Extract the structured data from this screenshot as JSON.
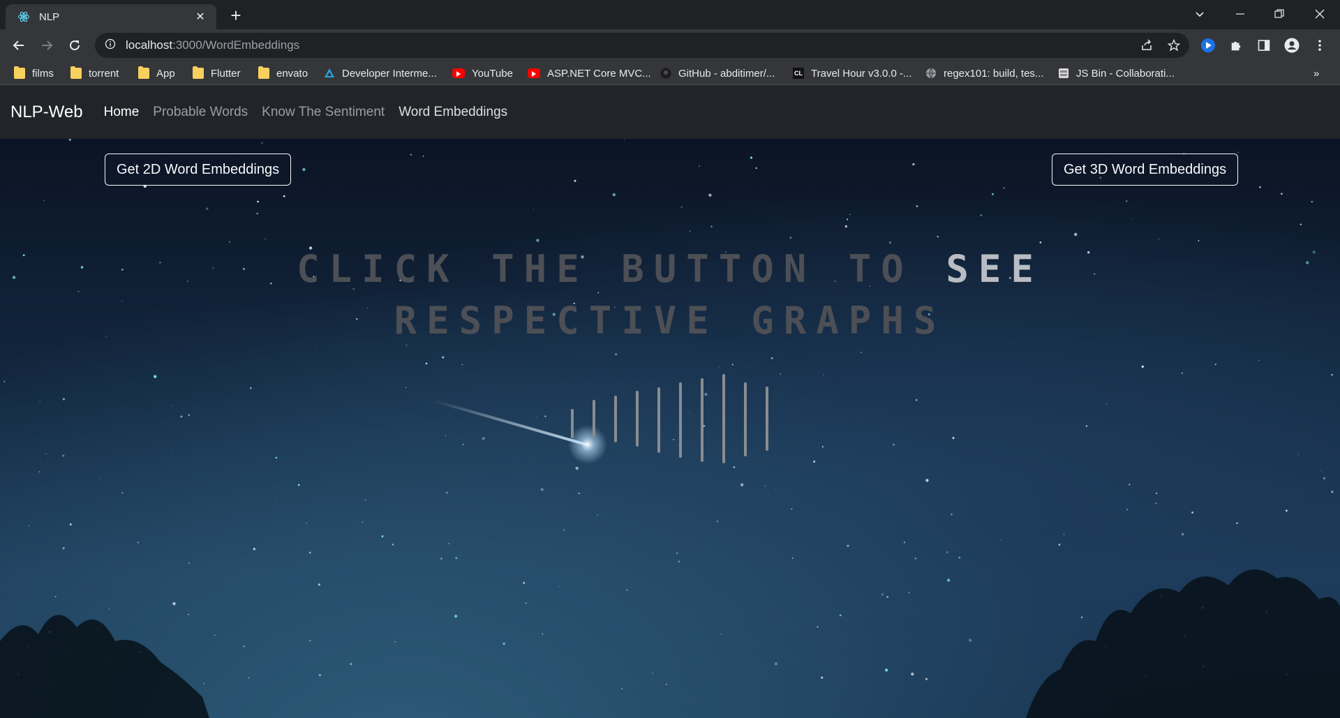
{
  "browser": {
    "tab_title": "NLP",
    "url_host": "localhost",
    "url_rest": ":3000/WordEmbeddings",
    "bookmarks": [
      {
        "label": "films",
        "icon": "folder-icon"
      },
      {
        "label": "torrent",
        "icon": "folder-icon"
      },
      {
        "label": "App",
        "icon": "folder-icon"
      },
      {
        "label": "Flutter",
        "icon": "folder-icon"
      },
      {
        "label": "envato",
        "icon": "folder-icon"
      },
      {
        "label": "Developer Interme...",
        "icon": "developer-icon"
      },
      {
        "label": "YouTube",
        "icon": "youtube-icon"
      },
      {
        "label": "ASP.NET Core MVC...",
        "icon": "youtube-icon"
      },
      {
        "label": "GitHub - abditimer/...",
        "icon": "github-icon"
      },
      {
        "label": "Travel Hour v3.0.0 -...",
        "icon": "cl-icon"
      },
      {
        "label": "regex101: build, tes...",
        "icon": "globe-icon"
      },
      {
        "label": "JS Bin - Collaborati...",
        "icon": "jsbin-icon"
      }
    ],
    "more_bookmarks": "»"
  },
  "app": {
    "brand": "NLP-Web",
    "nav": [
      "Home",
      "Probable Words",
      "Know The Sentiment",
      "Word Embeddings"
    ],
    "btn_2d": "Get 2D Word Embeddings",
    "btn_3d": "Get 3D Word Embeddings",
    "headline_line1_dim": "CLICK THE BUTTON TO ",
    "headline_line1_bright": "SEE",
    "headline_line2": "RESPECTIVE GRAPHS",
    "accent": "#61dafb"
  }
}
